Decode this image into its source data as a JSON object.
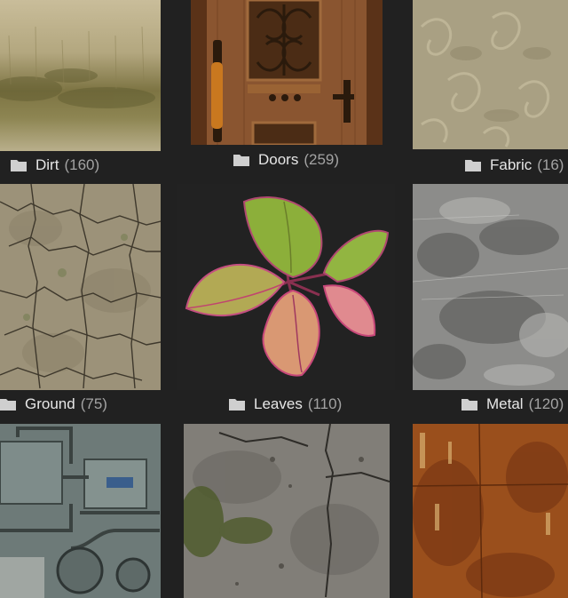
{
  "folders": [
    {
      "name": "Dirt",
      "count": "(160)",
      "icon": "folder-icon"
    },
    {
      "name": "Doors",
      "count": "(259)",
      "icon": "folder-icon"
    },
    {
      "name": "Fabric",
      "count": "(16)",
      "icon": "folder-icon"
    },
    {
      "name": "Ground",
      "count": "(75)",
      "icon": "folder-icon"
    },
    {
      "name": "Leaves",
      "count": "(110)",
      "icon": "folder-icon"
    },
    {
      "name": "Metal",
      "count": "(120)",
      "icon": "folder-icon"
    },
    {
      "name": "",
      "count": "",
      "icon": "folder-icon"
    },
    {
      "name": "",
      "count": "",
      "icon": "folder-icon"
    },
    {
      "name": "",
      "count": "",
      "icon": "folder-icon"
    }
  ],
  "colors": {
    "background": "#212121",
    "label_text": "#e6e6e6",
    "count_text": "#a3a3a3"
  }
}
